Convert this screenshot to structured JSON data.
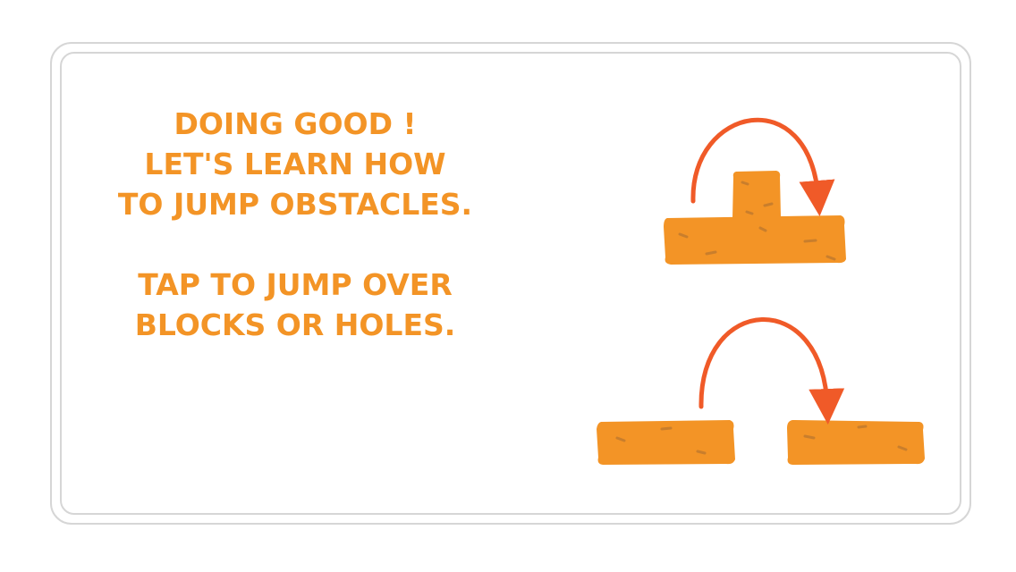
{
  "tutorial": {
    "heading_lines": [
      "DOING GOOD !",
      "LET'S LEARN HOW",
      "TO JUMP OBSTACLES."
    ],
    "instruction_lines": [
      "TAP TO JUMP OVER",
      "BLOCKS OR HOLES."
    ]
  },
  "colors": {
    "text": "#f39426",
    "block": "#f39426",
    "block_crack": "#c97e2c",
    "arrow": "#f05a28",
    "panel_border": "#d6d6d6",
    "background": "#ffffff"
  },
  "icons": {
    "block_jump": "jump-over-block-illustration",
    "hole_jump": "jump-over-hole-illustration"
  }
}
